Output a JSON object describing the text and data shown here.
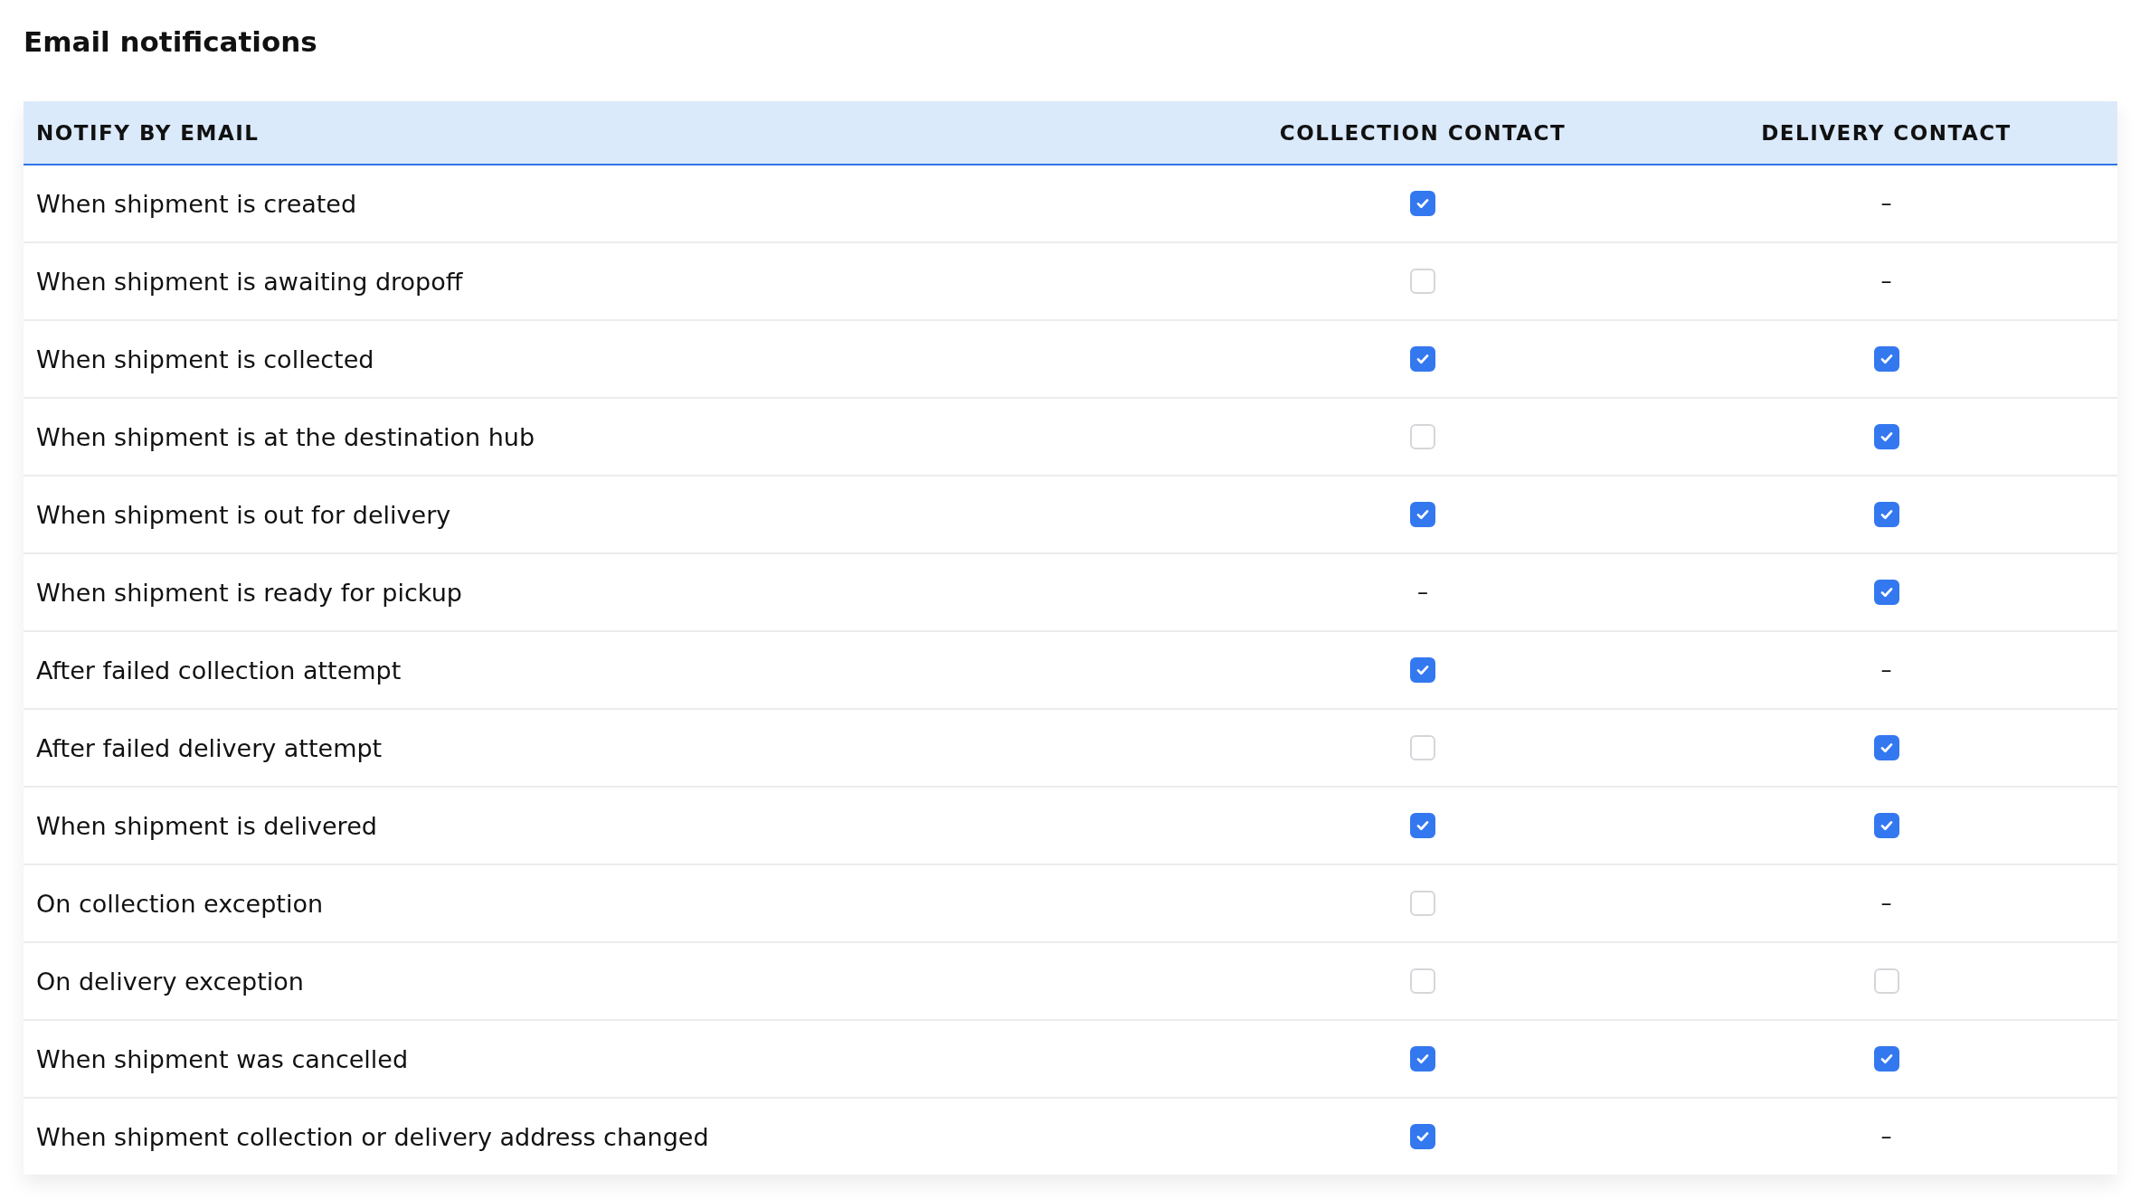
{
  "title": "Email notifications",
  "table": {
    "columns": [
      "NOTIFY BY EMAIL",
      "COLLECTION CONTACT",
      "DELIVERY CONTACT"
    ],
    "rows": [
      {
        "cells": [
          {
            "kind": "text",
            "text": "When shipment is created"
          },
          {
            "kind": "checkbox",
            "checked": true
          },
          {
            "kind": "dash",
            "text": "–"
          }
        ]
      },
      {
        "cells": [
          {
            "kind": "text",
            "text": "When shipment is awaiting dropoff"
          },
          {
            "kind": "checkbox",
            "checked": false
          },
          {
            "kind": "dash",
            "text": "–"
          }
        ]
      },
      {
        "cells": [
          {
            "kind": "text",
            "text": "When shipment is collected"
          },
          {
            "kind": "checkbox",
            "checked": true
          },
          {
            "kind": "checkbox",
            "checked": true
          }
        ]
      },
      {
        "cells": [
          {
            "kind": "text",
            "text": "When shipment is at the destination hub"
          },
          {
            "kind": "checkbox",
            "checked": false
          },
          {
            "kind": "checkbox",
            "checked": true
          }
        ]
      },
      {
        "cells": [
          {
            "kind": "text",
            "text": "When shipment is out for delivery"
          },
          {
            "kind": "checkbox",
            "checked": true
          },
          {
            "kind": "checkbox",
            "checked": true
          }
        ]
      },
      {
        "cells": [
          {
            "kind": "text",
            "text": "When shipment is ready for pickup"
          },
          {
            "kind": "dash",
            "text": "–"
          },
          {
            "kind": "checkbox",
            "checked": true
          }
        ]
      },
      {
        "cells": [
          {
            "kind": "text",
            "text": "After failed collection attempt"
          },
          {
            "kind": "checkbox",
            "checked": true
          },
          {
            "kind": "dash",
            "text": "–"
          }
        ]
      },
      {
        "cells": [
          {
            "kind": "text",
            "text": "After failed delivery attempt"
          },
          {
            "kind": "checkbox",
            "checked": false
          },
          {
            "kind": "checkbox",
            "checked": true
          }
        ]
      },
      {
        "cells": [
          {
            "kind": "text",
            "text": "When shipment is delivered"
          },
          {
            "kind": "checkbox",
            "checked": true
          },
          {
            "kind": "checkbox",
            "checked": true
          }
        ]
      },
      {
        "cells": [
          {
            "kind": "text",
            "text": "On collection exception"
          },
          {
            "kind": "checkbox",
            "checked": false
          },
          {
            "kind": "dash",
            "text": "–"
          }
        ]
      },
      {
        "cells": [
          {
            "kind": "text",
            "text": "On delivery exception"
          },
          {
            "kind": "checkbox",
            "checked": false
          },
          {
            "kind": "checkbox",
            "checked": false
          }
        ]
      },
      {
        "cells": [
          {
            "kind": "text",
            "text": "When shipment was cancelled"
          },
          {
            "kind": "checkbox",
            "checked": true
          },
          {
            "kind": "checkbox",
            "checked": true
          }
        ]
      },
      {
        "cells": [
          {
            "kind": "text",
            "text": "When shipment collection or delivery address changed"
          },
          {
            "kind": "checkbox",
            "checked": true
          },
          {
            "kind": "dash",
            "text": "–"
          }
        ]
      }
    ]
  }
}
